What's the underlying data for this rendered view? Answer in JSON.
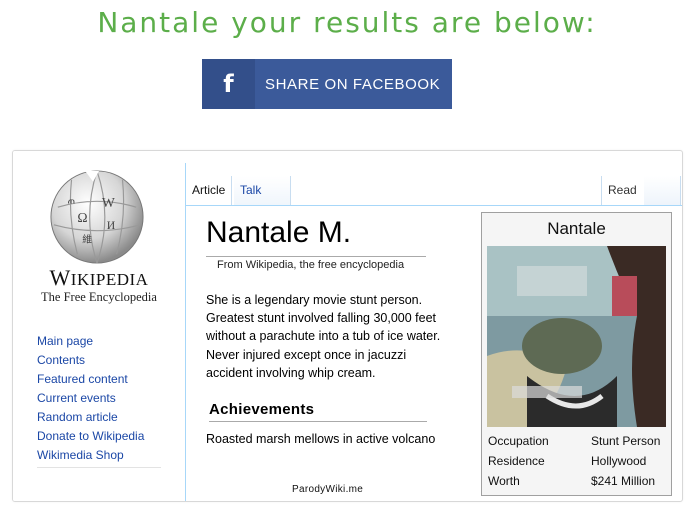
{
  "headline": "Nantale your results are below:",
  "share_button": {
    "icon": "f",
    "label": "SHARE ON FACEBOOK"
  },
  "sidebar": {
    "logo_name_first": "W",
    "logo_name_rest": "IKIPEDIA",
    "logo_tagline": "The Free Encyclopedia",
    "nav": [
      "Main page",
      "Contents",
      "Featured content",
      "Current events",
      "Random article",
      "Donate to Wikipedia",
      "Wikimedia Shop"
    ]
  },
  "tabs": {
    "article": "Article",
    "talk": "Talk",
    "read": "Read"
  },
  "article": {
    "title": "Nantale M.",
    "from": "From Wikipedia, the free encyclopedia",
    "body": "She is a legendary movie stunt person. Greatest stunt involved falling 30,000 feet without a parachute into a tub of ice water. Never injured except once in jacuzzi accident involving whip cream.",
    "section_title": "Achievements",
    "section_text": "Roasted marsh mellows in active volcano",
    "credit": "ParodyWiki.me"
  },
  "infobox": {
    "name": "Nantale",
    "rows": [
      {
        "key": "Occupation",
        "value": "Stunt Person"
      },
      {
        "key": "Residence",
        "value": "Hollywood"
      },
      {
        "key": "Worth",
        "value": "$241 Million"
      }
    ]
  },
  "colors": {
    "headline": "#5cae4a",
    "facebook": "#3b5a9a",
    "link": "#1b47a6",
    "tab_border": "#a7d7f9"
  }
}
